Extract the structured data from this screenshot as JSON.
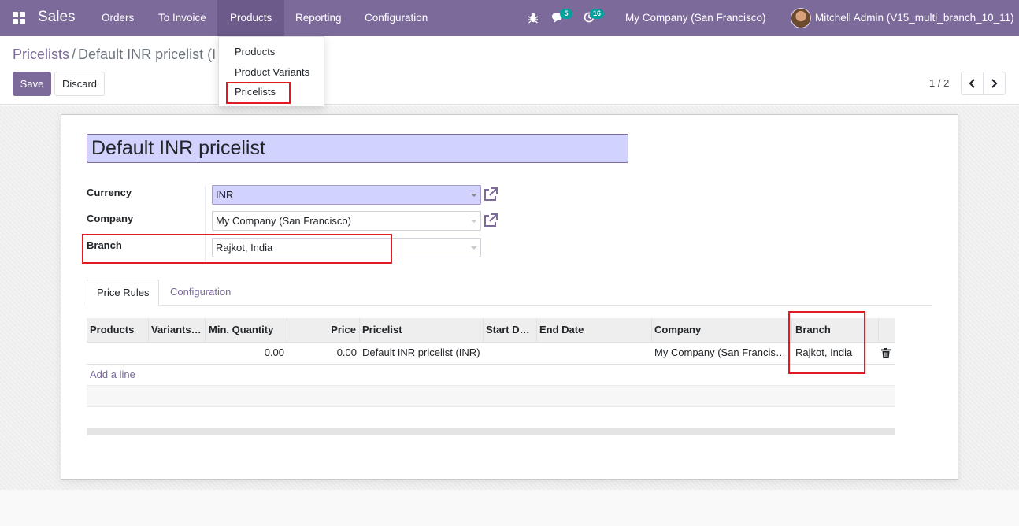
{
  "navbar": {
    "brand": "Sales",
    "menu": [
      "Orders",
      "To Invoice",
      "Products",
      "Reporting",
      "Configuration"
    ],
    "messages_count": "5",
    "activities_count": "16",
    "company": "My Company (San Francisco)",
    "user": "Mitchell Admin (V15_multi_branch_10_11)"
  },
  "dropdown": {
    "items": [
      "Products",
      "Product Variants",
      "Pricelists"
    ]
  },
  "breadcrumb": {
    "parent": "Pricelists",
    "separator": "/",
    "current": "Default INR pricelist (I"
  },
  "actions": {
    "save": "Save",
    "discard": "Discard"
  },
  "pager": {
    "value": "1 / 2"
  },
  "form": {
    "name": "Default INR pricelist",
    "fields": {
      "currency_label": "Currency",
      "currency_value": "INR",
      "company_label": "Company",
      "company_value": "My Company (San Francisco)",
      "branch_label": "Branch",
      "branch_value": "Rajkot, India"
    },
    "tabs": [
      "Price Rules",
      "Configuration"
    ],
    "table": {
      "headers": [
        "Products",
        "Variants…",
        "Min. Quantity",
        "Price",
        "Pricelist",
        "Start D…",
        "End Date",
        "Company",
        "Branch"
      ],
      "rows": [
        {
          "products": "",
          "variants": "",
          "min_quantity": "0.00",
          "price": "0.00",
          "pricelist": "Default INR pricelist (INR)",
          "start_date": "",
          "end_date": "",
          "company": "My Company (San Francis…",
          "branch": "Rajkot, India"
        }
      ],
      "add_line": "Add a line"
    }
  },
  "colors": {
    "brand": "#7c6a9a",
    "required_field": "#d2d2ff",
    "highlight_box": "#e01b24"
  }
}
